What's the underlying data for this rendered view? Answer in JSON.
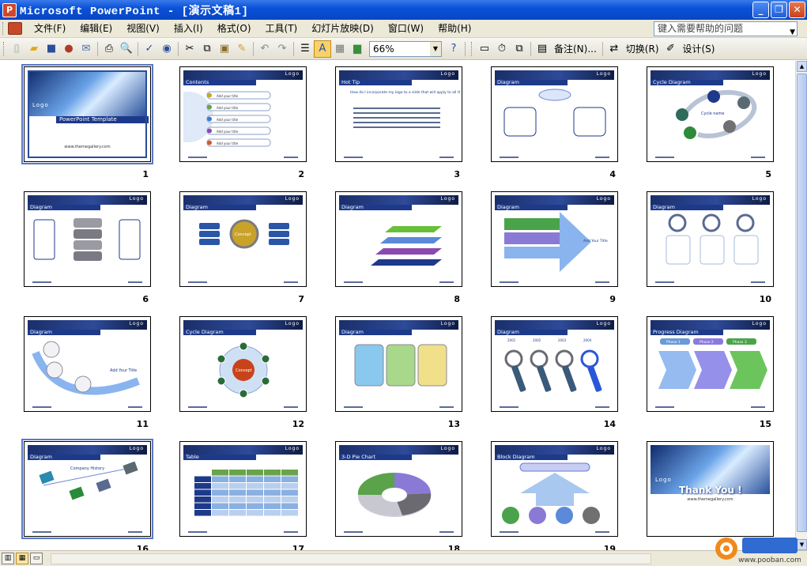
{
  "window": {
    "title": "Microsoft PowerPoint - [演示文稿1]",
    "app_icon_letter": "P",
    "minimize": "_",
    "restore": "❐",
    "close": "✕"
  },
  "menu": {
    "items": [
      "文件(F)",
      "编辑(E)",
      "视图(V)",
      "插入(I)",
      "格式(O)",
      "工具(T)",
      "幻灯片放映(D)",
      "窗口(W)",
      "帮助(H)"
    ],
    "help_placeholder": "键入需要帮助的问题"
  },
  "toolbar": {
    "zoom": "66%",
    "notes_label": "备注(N)...",
    "transition_label": "切换(R)",
    "design_label": "设计(S)"
  },
  "slides": [
    {
      "num": "1",
      "type": "title",
      "title": "PowerPoint Template",
      "logo": "Logo",
      "url": "www.themegallery.com"
    },
    {
      "num": "2",
      "type": "contents",
      "title": "Contents",
      "items": [
        "Add your title",
        "Add your title",
        "Add your title",
        "Add your title",
        "Add your title"
      ]
    },
    {
      "num": "3",
      "type": "hottip",
      "title": "Hot Tip",
      "text": "How do I incorporate my logo to a slide that will apply to all the other slides?"
    },
    {
      "num": "4",
      "type": "diagram",
      "title": "Diagram"
    },
    {
      "num": "5",
      "type": "cycle",
      "title": "Cycle Diagram",
      "center": "Cycle name"
    },
    {
      "num": "6",
      "type": "diagram",
      "title": "Diagram"
    },
    {
      "num": "7",
      "type": "diagram",
      "title": "Diagram",
      "center": "Concept"
    },
    {
      "num": "8",
      "type": "diagram",
      "title": "Diagram"
    },
    {
      "num": "9",
      "type": "diagram",
      "title": "Diagram",
      "side": "Add Your Title"
    },
    {
      "num": "10",
      "type": "diagram",
      "title": "Diagram"
    },
    {
      "num": "11",
      "type": "diagram",
      "title": "Diagram",
      "side": "Add Your Title"
    },
    {
      "num": "12",
      "type": "cycle",
      "title": "Cycle Diagram",
      "center": "Concept"
    },
    {
      "num": "13",
      "type": "diagram",
      "title": "Diagram"
    },
    {
      "num": "14",
      "type": "diagram",
      "title": "Diagram",
      "years": [
        "2001",
        "2002",
        "2003",
        "2004"
      ]
    },
    {
      "num": "15",
      "type": "progress",
      "title": "Progress Diagram",
      "phases": [
        "Phase 1",
        "Phase 2",
        "Phase 3"
      ]
    },
    {
      "num": "16",
      "type": "diagram",
      "title": "Diagram",
      "center": "Company History"
    },
    {
      "num": "17",
      "type": "table",
      "title": "Table"
    },
    {
      "num": "18",
      "type": "pie",
      "title": "3-D Pie Chart"
    },
    {
      "num": "19",
      "type": "block",
      "title": "Block Diagram"
    },
    {
      "num": "",
      "type": "end",
      "title": "Thank You !",
      "url": "www.themegallery.com"
    }
  ],
  "slide_logo": "Logo",
  "watermark": "www.pooban.com"
}
